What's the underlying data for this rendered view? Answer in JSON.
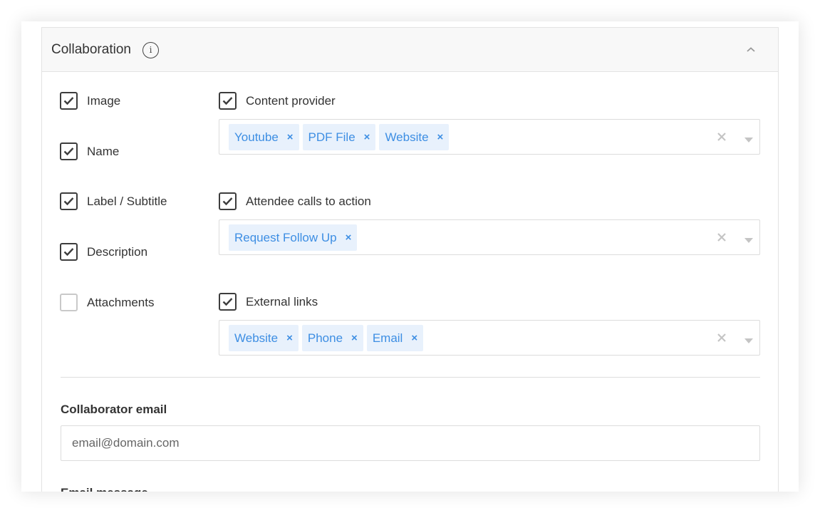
{
  "section": {
    "title": "Collaboration",
    "info_icon": "info-icon",
    "collapse_icon": "chevron-up-icon"
  },
  "left_checkboxes": [
    {
      "label": "Image",
      "checked": true
    },
    {
      "label": "Name",
      "checked": true
    },
    {
      "label": "Label / Subtitle",
      "checked": true
    },
    {
      "label": "Description",
      "checked": true
    },
    {
      "label": "Attachments",
      "checked": false
    }
  ],
  "right_groups": [
    {
      "label": "Content provider",
      "checked": true,
      "tags": [
        "Youtube",
        "PDF File",
        "Website"
      ]
    },
    {
      "label": "Attendee calls to action",
      "checked": true,
      "tags": [
        "Request Follow Up"
      ]
    },
    {
      "label": "External links",
      "checked": true,
      "tags": [
        "Website",
        "Phone",
        "Email"
      ]
    }
  ],
  "tag_remove_glyph": "×",
  "collaborator_email": {
    "label": "Collaborator email",
    "placeholder": "email@domain.com",
    "value": ""
  },
  "email_message": {
    "label": "Email message"
  },
  "colors": {
    "tag_background": "#e8f1fc",
    "tag_text": "#3d8ee3",
    "checkbox_border": "#3d3d3d",
    "header_background": "#f8f8f8"
  }
}
